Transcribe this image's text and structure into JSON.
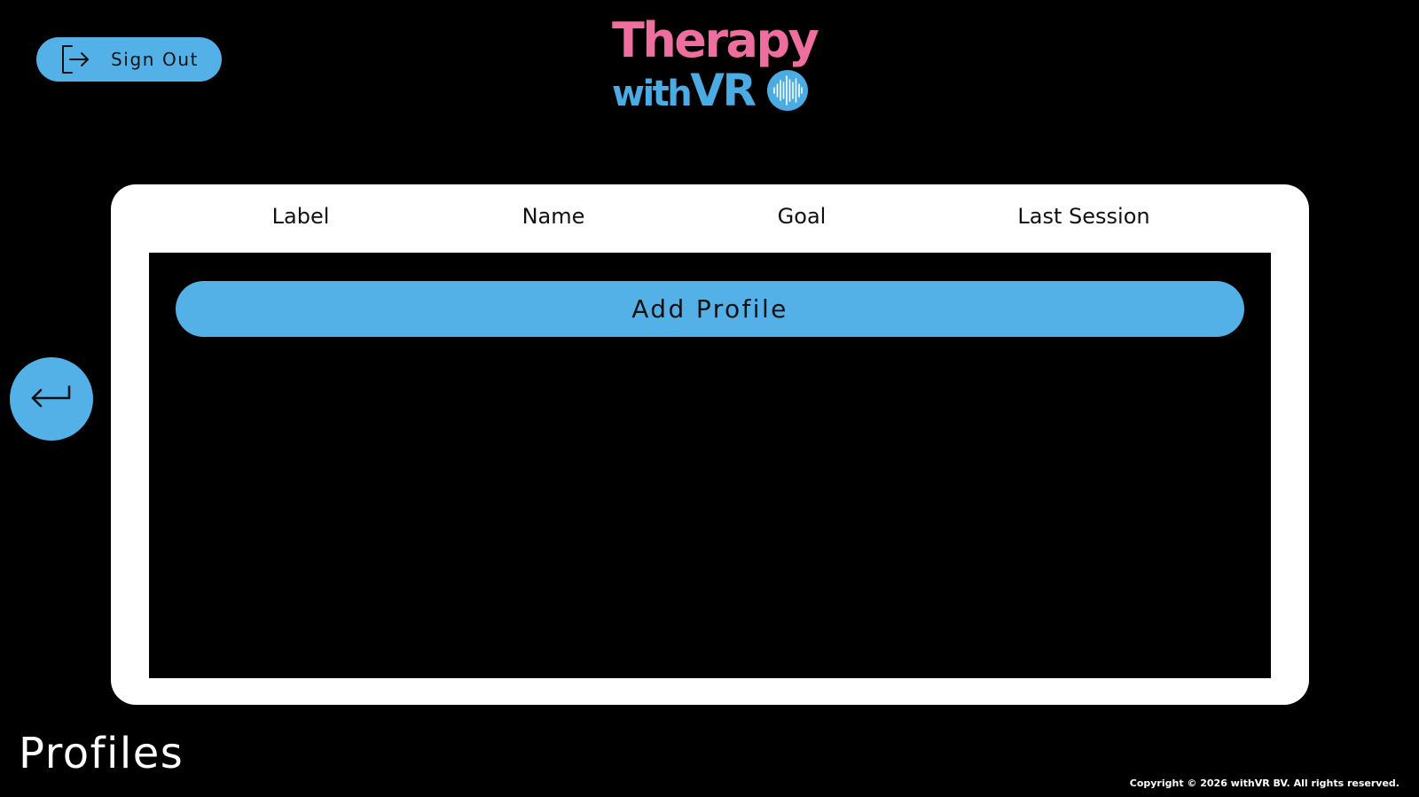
{
  "header": {
    "sign_out_label": "Sign Out",
    "logo": {
      "line1": "Therapy",
      "line2_with": "with",
      "line2_vr": "VR"
    }
  },
  "profiles_table": {
    "columns": [
      {
        "label": "Label"
      },
      {
        "label": "Name"
      },
      {
        "label": "Goal"
      },
      {
        "label": "Last Session"
      }
    ],
    "add_profile_label": "Add Profile"
  },
  "page_title": "Profiles",
  "footer": {
    "copyright": "Copyright © 2026 withVR BV. All rights reserved."
  },
  "icons": {
    "sign_out": "sign-out-icon",
    "back": "back-arrow-icon",
    "logo_mark": "soundwave-logo-icon"
  },
  "colors": {
    "background": "#000000",
    "accent_blue": "#53B1E7",
    "logo_pink": "#EE6F9F",
    "logo_blue": "#4BABE3",
    "card": "#FFFFFF"
  }
}
